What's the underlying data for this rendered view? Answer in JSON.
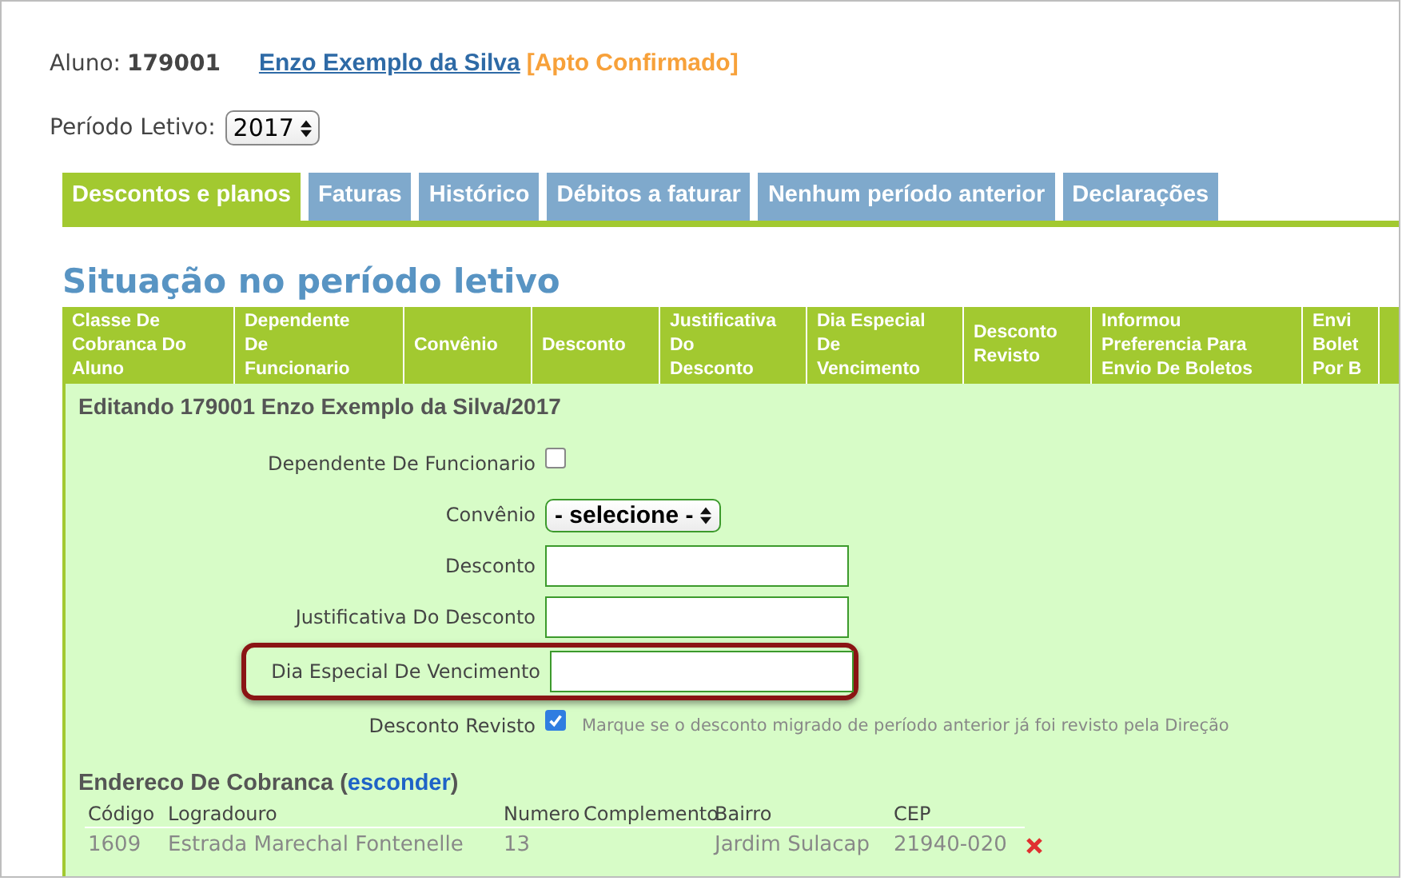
{
  "student": {
    "label": "Aluno:",
    "id": "179001",
    "name": "Enzo Exemplo da Silva",
    "status": "[Apto Confirmado]"
  },
  "period": {
    "label": "Período Letivo:",
    "value": "2017"
  },
  "tabs": [
    {
      "label": "Descontos e planos",
      "selected": true
    },
    {
      "label": "Faturas",
      "selected": false
    },
    {
      "label": "Histórico",
      "selected": false
    },
    {
      "label": "Débitos a faturar",
      "selected": false
    },
    {
      "label": "Nenhum período anterior",
      "selected": false
    },
    {
      "label": "Declarações",
      "selected": false
    }
  ],
  "section_title": "Situação no período letivo",
  "table": {
    "columns": [
      "Classe De\nCobranca Do\nAluno",
      "Dependente\nDe\nFuncionario",
      "Convênio",
      "Desconto",
      "Justificativa\nDo\nDesconto",
      "Dia Especial\nDe\nVencimento",
      "Desconto\nRevisto",
      "Informou\nPreferencia Para\nEnvio De Boletos",
      "Envi\nBolet\nPor B"
    ]
  },
  "edit_form": {
    "title": "Editando 179001 Enzo Exemplo da Silva/2017",
    "fields": [
      {
        "kind": "checkbox",
        "label": "Dependente De Funcionario",
        "checked": false
      },
      {
        "kind": "select",
        "label": "Convênio",
        "value": "- selecione -"
      },
      {
        "kind": "text",
        "label": "Desconto",
        "highlighted": false
      },
      {
        "kind": "text",
        "label": "Justificativa Do Desconto",
        "highlighted": false
      },
      {
        "kind": "text",
        "label": "Dia Especial De Vencimento",
        "highlighted": true
      },
      {
        "kind": "checkbox",
        "label": "Desconto Revisto",
        "checked": true,
        "hint": "Marque se o desconto migrado de período anterior já foi revisto pela Direção"
      }
    ]
  },
  "address": {
    "title": "Endereco De Cobranca (",
    "link": "esconder",
    "link_close": ")",
    "columns": [
      "Código",
      "Logradouro",
      "Numero",
      "Complemento",
      "Bairro",
      "CEP"
    ],
    "rows": [
      [
        "1609",
        "Estrada Marechal Fontenelle",
        "13",
        "",
        "Jardim Sulacap",
        "21940-020"
      ]
    ]
  }
}
